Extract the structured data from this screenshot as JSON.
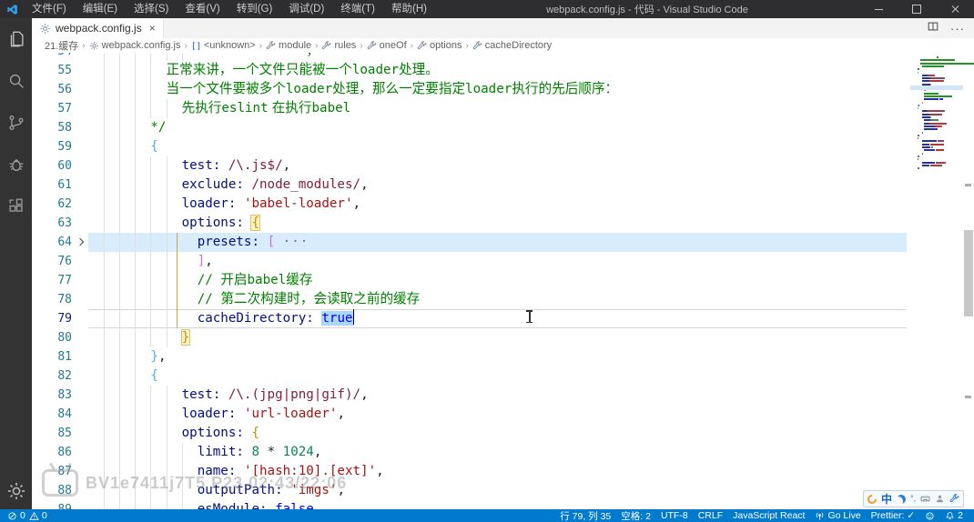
{
  "window": {
    "title": "webpack.config.js - 代码 - Visual Studio Code",
    "menu": [
      "文件(F)",
      "编辑(E)",
      "选择(S)",
      "查看(V)",
      "转到(G)",
      "调试(D)",
      "终端(T)",
      "帮助(H)"
    ]
  },
  "tab": {
    "label": "webpack.config.js",
    "close_glyph": "×"
  },
  "tabbar": {
    "more_glyph": "···"
  },
  "breadcrumb": {
    "items": [
      {
        "label": "21.缓存",
        "icon": ""
      },
      {
        "label": "webpack.config.js",
        "icon": "gear"
      },
      {
        "label": "<unknown>",
        "icon": "brackets"
      },
      {
        "label": "module",
        "icon": "wrench"
      },
      {
        "label": "rules",
        "icon": "wrench"
      },
      {
        "label": "oneOf",
        "icon": "wrench"
      },
      {
        "label": "options",
        "icon": "wrench"
      },
      {
        "label": "cacheDirectory",
        "icon": "wrench"
      }
    ]
  },
  "colors": {
    "statusbar": "#007acc",
    "titlebar": "#2e2e31",
    "activitybar": "#333333",
    "comment": "#008000",
    "property": "#001080",
    "string": "#a31515",
    "regex": "#811f3f",
    "keyword": "#0000ff",
    "number": "#098658",
    "bracket_blue": "#56b0e8",
    "bracket_gold": "#b89500",
    "bracket_orchid": "#cf6ccf",
    "line_highlight": "#d9ecfc",
    "selection": "#add6ff"
  },
  "editor": {
    "lines": [
      {
        "n": "54",
        "ind": 28,
        "tokens": [
          [
            "，",
            "comment"
          ]
        ]
      },
      {
        "n": "55",
        "ind": 10,
        "tokens": [
          [
            "正常来讲，一个文件只能被一个",
            "comment"
          ],
          [
            "loader",
            "commentMono"
          ],
          [
            "处理。",
            "comment"
          ]
        ]
      },
      {
        "n": "56",
        "ind": 10,
        "tokens": [
          [
            "当一个文件要被多个",
            "comment"
          ],
          [
            "loader",
            "commentMono"
          ],
          [
            "处理，那么一定要指定",
            "comment"
          ],
          [
            "loader",
            "commentMono"
          ],
          [
            "执行的先后顺序：",
            "comment"
          ]
        ]
      },
      {
        "n": "57",
        "ind": 12,
        "tokens": [
          [
            "先执行",
            "comment"
          ],
          [
            "eslint",
            "commentMono"
          ],
          [
            " 在执行",
            "comment"
          ],
          [
            "babel",
            "commentMono"
          ]
        ]
      },
      {
        "n": "58",
        "ind": 8,
        "tokens": [
          [
            "*/",
            "commentMono"
          ]
        ]
      },
      {
        "n": "59",
        "ind": 8,
        "tokens": [
          [
            "{",
            "bracketBlue"
          ]
        ]
      },
      {
        "n": "60",
        "ind": 12,
        "tokens": [
          [
            "test: ",
            "prop"
          ],
          [
            "/\\.js$/",
            "regex"
          ],
          [
            ",",
            "plain"
          ]
        ]
      },
      {
        "n": "61",
        "ind": 12,
        "tokens": [
          [
            "exclude: ",
            "prop"
          ],
          [
            "/node_modules/",
            "regex"
          ],
          [
            ",",
            "plain"
          ]
        ]
      },
      {
        "n": "62",
        "ind": 12,
        "tokens": [
          [
            "loader: ",
            "prop"
          ],
          [
            "'babel-loader'",
            "string"
          ],
          [
            ",",
            "plain"
          ]
        ]
      },
      {
        "n": "63",
        "ind": 12,
        "tokens": [
          [
            "options: ",
            "prop"
          ],
          [
            "{",
            "bracketGold",
            "match"
          ]
        ]
      },
      {
        "n": "64",
        "ind": 14,
        "fold": true,
        "hl": true,
        "tokens": [
          [
            "presets: ",
            "prop"
          ],
          [
            "[",
            "bracketOrchid"
          ],
          [
            " ",
            "plain"
          ],
          [
            "···",
            "fold"
          ]
        ]
      },
      {
        "n": "76",
        "ind": 14,
        "tokens": [
          [
            "]",
            "bracketOrchid"
          ],
          [
            ",",
            "plain"
          ]
        ]
      },
      {
        "n": "77",
        "ind": 14,
        "tokens": [
          [
            "// ",
            "commentMono"
          ],
          [
            "开启",
            "comment"
          ],
          [
            "babel",
            "commentMono"
          ],
          [
            "缓存",
            "comment"
          ]
        ]
      },
      {
        "n": "78",
        "ind": 14,
        "tokens": [
          [
            "// ",
            "commentMono"
          ],
          [
            "第二次构建时，会读取之前的缓存",
            "comment"
          ]
        ]
      },
      {
        "n": "79",
        "ind": 14,
        "cur": true,
        "tokens": [
          [
            "cacheDirectory: ",
            "prop"
          ],
          [
            "true",
            "keyword",
            "sel"
          ]
        ]
      },
      {
        "n": "80",
        "ind": 12,
        "tokens": [
          [
            "}",
            "bracketGold",
            "match"
          ]
        ]
      },
      {
        "n": "81",
        "ind": 8,
        "tokens": [
          [
            "}",
            "bracketBlue"
          ],
          [
            ",",
            "plain"
          ]
        ]
      },
      {
        "n": "82",
        "ind": 8,
        "tokens": [
          [
            "{",
            "bracketBlue"
          ]
        ]
      },
      {
        "n": "83",
        "ind": 12,
        "tokens": [
          [
            "test: ",
            "prop"
          ],
          [
            "/\\.(jpg|png|gif)/",
            "regex"
          ],
          [
            ",",
            "plain"
          ]
        ]
      },
      {
        "n": "84",
        "ind": 12,
        "tokens": [
          [
            "loader: ",
            "prop"
          ],
          [
            "'url-loader'",
            "string"
          ],
          [
            ",",
            "plain"
          ]
        ]
      },
      {
        "n": "85",
        "ind": 12,
        "tokens": [
          [
            "options: ",
            "prop"
          ],
          [
            "{",
            "bracketGold"
          ]
        ]
      },
      {
        "n": "86",
        "ind": 14,
        "tokens": [
          [
            "limit: ",
            "prop"
          ],
          [
            "8",
            "number"
          ],
          [
            " * ",
            "plain"
          ],
          [
            "1024",
            "number"
          ],
          [
            ",",
            "plain"
          ]
        ]
      },
      {
        "n": "87",
        "ind": 14,
        "tokens": [
          [
            "name: ",
            "prop"
          ],
          [
            "'[hash:10].[ext]'",
            "string"
          ],
          [
            ",",
            "plain"
          ]
        ]
      },
      {
        "n": "88",
        "ind": 14,
        "tokens": [
          [
            "outputPath: ",
            "prop"
          ],
          [
            "'imgs'",
            "string"
          ],
          [
            ",",
            "plain"
          ]
        ]
      },
      {
        "n": "89",
        "ind": 14,
        "tokens": [
          [
            "esModule: ",
            "prop"
          ],
          [
            "false",
            "keyword"
          ]
        ]
      }
    ],
    "cursor": {
      "line": "79",
      "col": 35
    }
  },
  "minimap_extra": [
    [
      [
        12,
        1,
        "plain"
      ]
    ],
    [
      [
        8,
        2,
        "plain"
      ]
    ],
    [
      [
        8,
        1,
        "plain"
      ]
    ],
    [
      [
        12,
        16,
        "prop"
      ],
      [
        29,
        6,
        "regex"
      ]
    ],
    [
      [
        12,
        8,
        "prop"
      ],
      [
        21,
        14,
        "string"
      ]
    ],
    [
      [
        12,
        9,
        "prop"
      ],
      [
        22,
        2,
        "plain"
      ]
    ],
    [
      [
        14,
        12,
        "prop"
      ],
      [
        27,
        8,
        "string"
      ]
    ],
    [
      [
        12,
        1,
        "plain"
      ]
    ],
    [
      [
        8,
        2,
        "plain"
      ]
    ],
    [
      [
        8,
        1,
        "plain"
      ]
    ],
    [
      [
        12,
        14,
        "prop"
      ],
      [
        27,
        10,
        "regex"
      ]
    ],
    [
      [
        12,
        8,
        "prop"
      ],
      [
        21,
        12,
        "string"
      ]
    ],
    [
      [
        8,
        2,
        "plain"
      ]
    ]
  ],
  "watermark": {
    "text": "BV1e7411j7T5 P23 02:43/22:06"
  },
  "status": {
    "left": [
      {
        "icon": "error",
        "label": "0"
      },
      {
        "icon": "warning",
        "label": "0"
      }
    ],
    "right": [
      {
        "icon": "",
        "label": "行 79, 列 35"
      },
      {
        "icon": "",
        "label": "空格: 2"
      },
      {
        "icon": "",
        "label": "UTF-8"
      },
      {
        "icon": "",
        "label": "CRLF"
      },
      {
        "icon": "",
        "label": "JavaScript React"
      },
      {
        "icon": "broadcast",
        "label": "Go Live"
      },
      {
        "icon": "",
        "label": "Prettier: ✓"
      },
      {
        "icon": "smiley",
        "label": ""
      },
      {
        "icon": "bell",
        "label": "2"
      }
    ]
  }
}
